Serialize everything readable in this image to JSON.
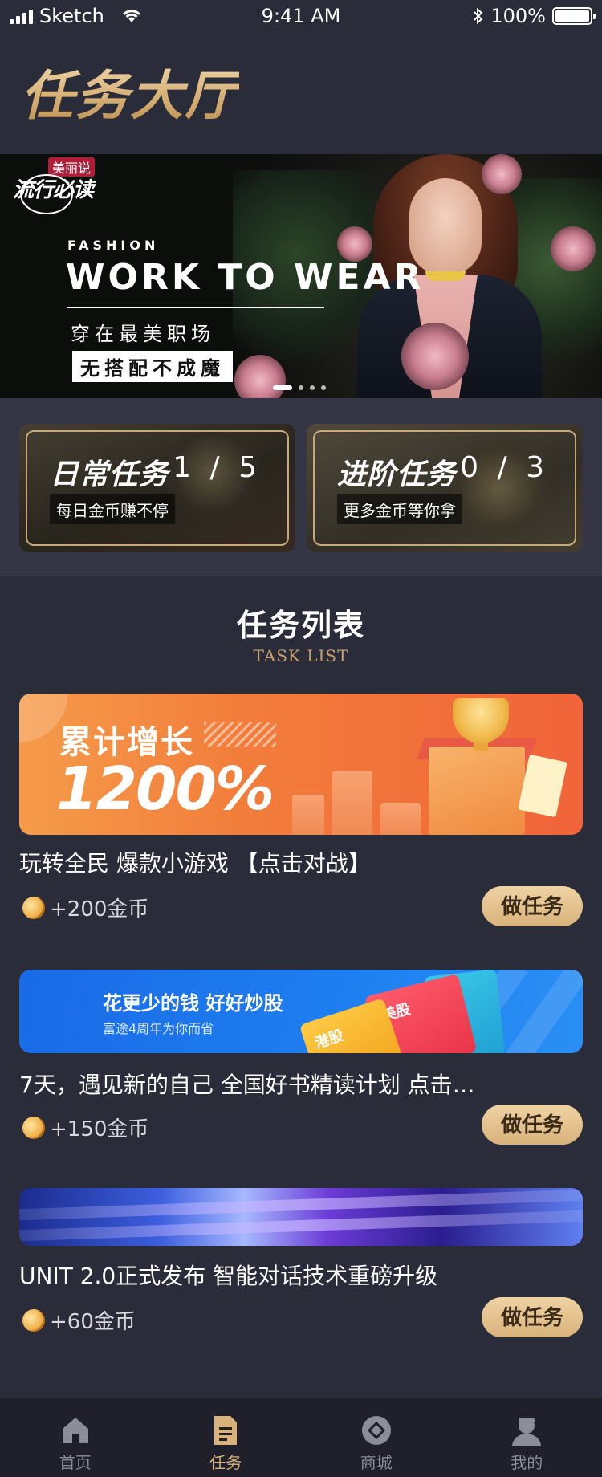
{
  "status_bar": {
    "carrier": "Sketch",
    "time": "9:41 AM",
    "battery": "100%",
    "icons": [
      "signal-icon",
      "wifi-icon",
      "bluetooth-icon",
      "battery-icon"
    ]
  },
  "header": {
    "title": "任务大厅"
  },
  "banner": {
    "logo_top": "美丽说",
    "logo": "流行必读",
    "kicker": "FASHION",
    "headline": "WORK TO WEAR",
    "line1": "穿在最美职场",
    "line2": "无搭配不成魔",
    "slide_count": 4,
    "active_slide": 1
  },
  "task_categories": [
    {
      "title": "日常任务",
      "progress": "1 / 5",
      "subtitle": "每日金币赚不停"
    },
    {
      "title": "进阶任务",
      "progress": "0 / 3",
      "subtitle": "更多金币等你拿"
    }
  ],
  "task_list": {
    "title": "任务列表",
    "subtitle": "TASK LIST",
    "items": [
      {
        "thumb": {
          "headline": "累计增长",
          "figure": "1200%"
        },
        "name": "玩转全民 爆款小游戏 【点击对战】",
        "reward": "+200金币",
        "button": "做任务"
      },
      {
        "thumb": {
          "headline": "花更少的钱 好好炒股",
          "sub": "富途4周年为你而省",
          "card1": "美股",
          "card2": "港股",
          "card3": "港股"
        },
        "name": "7天，遇见新的自己 全国好书精读计划 点击…",
        "reward": "+150金币",
        "button": "做任务"
      },
      {
        "thumb": {},
        "name": "UNIT 2.0正式发布 智能对话技术重磅升级",
        "reward": "+60金币",
        "button": "做任务"
      }
    ]
  },
  "tab_bar": {
    "items": [
      {
        "label": "首页",
        "icon": "home-icon",
        "active": false
      },
      {
        "label": "任务",
        "icon": "document-icon",
        "active": true
      },
      {
        "label": "商城",
        "icon": "shop-icon",
        "active": false
      },
      {
        "label": "我的",
        "icon": "user-icon",
        "active": false
      }
    ]
  },
  "colors": {
    "background": "#2b2c3a",
    "gold_accent": "#d8b27a",
    "tab_inactive": "#8b8d99",
    "tab_bar_bg": "#1f2029"
  }
}
